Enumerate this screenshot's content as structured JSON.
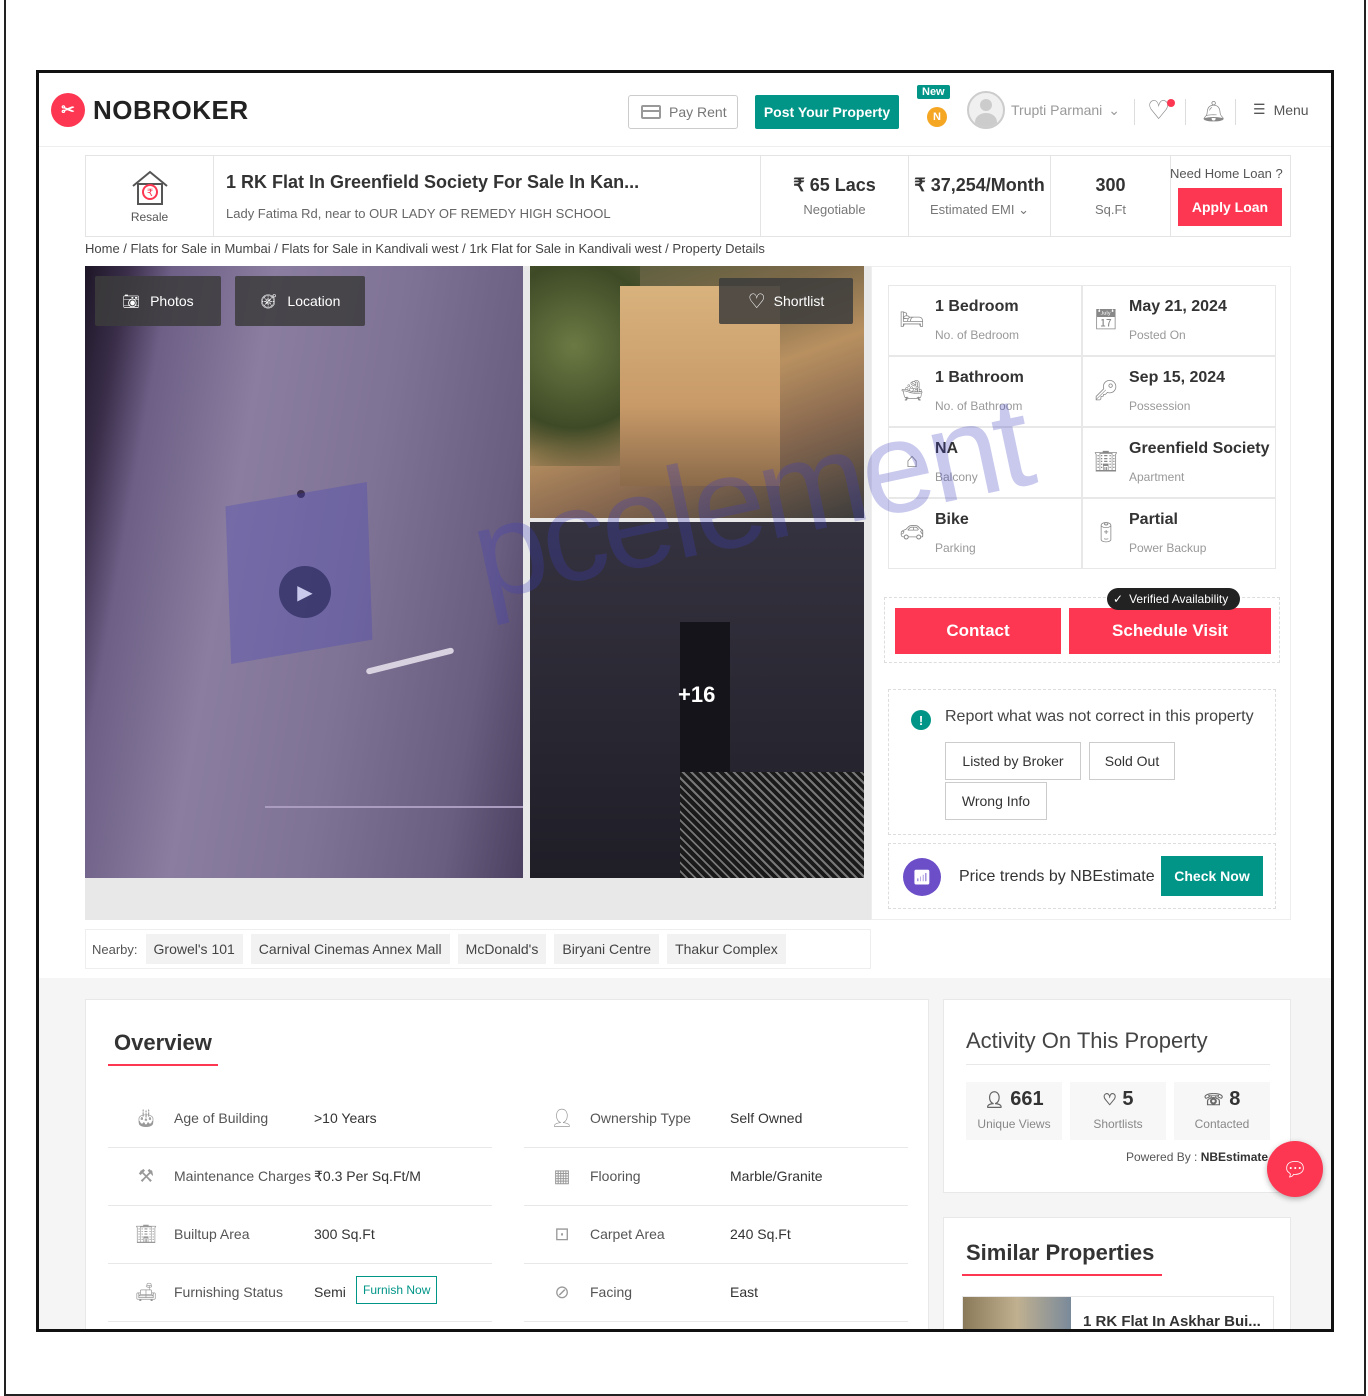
{
  "header": {
    "logo_text": "NOBROKER",
    "pay_rent": "Pay Rent",
    "post_property": "Post Your Property",
    "new_badge": "New",
    "coin": "N",
    "user_name": "Trupti Parmani",
    "menu": "Menu"
  },
  "titlebar": {
    "type_label": "Resale",
    "title": "1 RK Flat In Greenfield Society For Sale In Kan...",
    "address": "Lady Fatima Rd, near to OUR LADY OF REMEDY HIGH SCHOOL",
    "price": "₹ 65 Lacs",
    "price_note": "Negotiable",
    "emi": "₹ 37,254/Month",
    "emi_note": "Estimated EMI",
    "area": "300",
    "area_unit": "Sq.Ft",
    "loan_question": "Need Home Loan ?",
    "apply_loan": "Apply Loan"
  },
  "breadcrumb": "Home / Flats for Sale in Mumbai / Flats for Sale in Kandivali west / 1rk Flat for Sale in Kandivali west / Property Details",
  "gallery": {
    "photos": "Photos",
    "location": "Location",
    "shortlist": "Shortlist",
    "more_count": "+16"
  },
  "details": [
    {
      "value": "1 Bedroom",
      "label": "No. of Bedroom",
      "icon": "bed-icon"
    },
    {
      "value": "May 21, 2024",
      "label": "Posted On",
      "icon": "calendar-icon"
    },
    {
      "value": "1 Bathroom",
      "label": "No. of Bathroom",
      "icon": "bathtub-icon"
    },
    {
      "value": "Sep 15, 2024",
      "label": "Possession",
      "icon": "key-icon"
    },
    {
      "value": "NA",
      "label": "Balcony",
      "icon": "balcony-icon"
    },
    {
      "value": "Greenfield Society",
      "label": "Apartment",
      "icon": "building-icon"
    },
    {
      "value": "Bike",
      "label": "Parking",
      "icon": "car-icon"
    },
    {
      "value": "Partial",
      "label": "Power Backup",
      "icon": "battery-icon"
    }
  ],
  "cta": {
    "contact": "Contact",
    "schedule_visit": "Schedule Visit",
    "verified": "Verified Availability"
  },
  "report": {
    "title": "Report what was not correct in this property",
    "options": [
      "Listed by Broker",
      "Sold Out",
      "Wrong Info"
    ]
  },
  "price_trends": {
    "text": "Price trends by NBEstimate",
    "button": "Check Now"
  },
  "nearby": {
    "label": "Nearby:",
    "places": [
      "Growel's 101",
      "Carnival Cinemas Annex Mall",
      "McDonald's",
      "Biryani Centre",
      "Thakur Complex"
    ]
  },
  "overview": {
    "title": "Overview",
    "left": [
      {
        "key": "Age of Building",
        "value": ">10 Years",
        "icon": "cake-icon"
      },
      {
        "key": "Maintenance Charges",
        "value": "₹0.3 Per Sq.Ft/M",
        "icon": "tools-icon"
      },
      {
        "key": "Builtup Area",
        "value": "300 Sq.Ft",
        "icon": "building-icon"
      },
      {
        "key": "Furnishing Status",
        "value": "Semi",
        "icon": "sofa-icon"
      }
    ],
    "right": [
      {
        "key": "Ownership Type",
        "value": "Self Owned",
        "icon": "person-icon"
      },
      {
        "key": "Flooring",
        "value": "Marble/Granite",
        "icon": "grid-icon"
      },
      {
        "key": "Carpet Area",
        "value": "240 Sq.Ft",
        "icon": "floorplan-icon"
      },
      {
        "key": "Facing",
        "value": "East",
        "icon": "compass-icon"
      }
    ],
    "furnish_now": "Furnish Now"
  },
  "activity": {
    "title": "Activity On This Property",
    "stats": [
      {
        "value": "661",
        "label": "Unique Views",
        "icon": "user-icon"
      },
      {
        "value": "5",
        "label": "Shortlists",
        "icon": "heart-icon"
      },
      {
        "value": "8",
        "label": "Contacted",
        "icon": "phone-icon"
      }
    ],
    "powered_by": "Powered By :",
    "powered_name": "NBEstimate"
  },
  "similar": {
    "title": "Similar Properties",
    "first": "1 RK Flat In Askhar Bui..."
  },
  "watermark": "pcelement"
}
